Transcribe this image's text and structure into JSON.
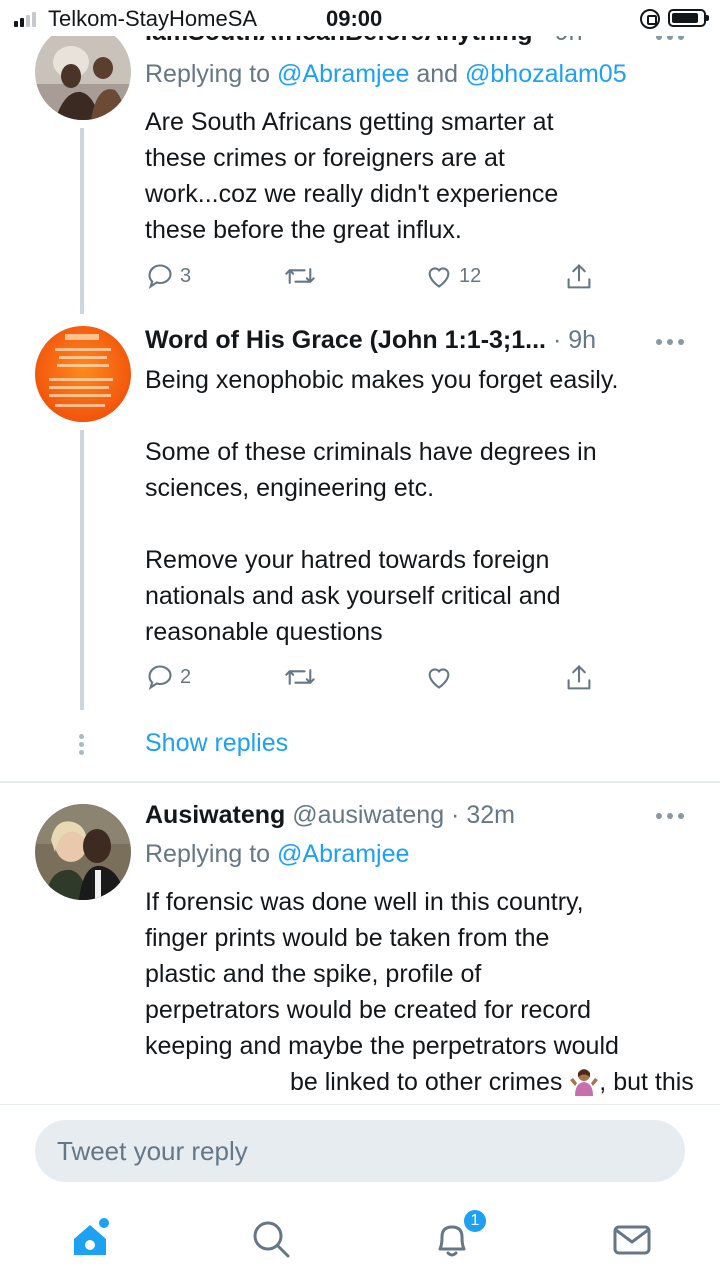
{
  "status_bar": {
    "carrier": "Telkom-StayHomeSA",
    "time": "09:00"
  },
  "tweets": [
    {
      "name": "IamSouthAfricanBeforeAnything",
      "time": "9h",
      "replying_prefix": "Replying to ",
      "mention_1": "@Abramjee",
      "replying_joiner": " and ",
      "mention_2": "@bhozalam05",
      "lines": [
        "Are South Africans getting smarter at",
        "these crimes or foreigners are at",
        "work...coz we really didn't experience",
        "these before the great influx."
      ],
      "reply_count": "3",
      "retweet_count": "",
      "like_count": "12"
    },
    {
      "name": "Word of His Grace (John 1:1-3;1...",
      "time": "9h",
      "paragraphs": [
        [
          "Being xenophobic makes you forget easily."
        ],
        [
          "Some of these criminals have degrees in",
          "sciences, engineering etc."
        ],
        [
          "Remove your hatred towards foreign",
          "nationals and ask yourself critical and",
          "reasonable questions"
        ]
      ],
      "reply_count": "2",
      "retweet_count": "",
      "like_count": ""
    },
    {
      "name": "Ausiwateng",
      "handle": "@ausiwateng",
      "time": "32m",
      "replying_prefix": "Replying to ",
      "mention_1": "@Abramjee",
      "lines": [
        "If forensic was done well in this country,",
        "finger prints would be taken from the",
        "plastic and the spike, profile of",
        "perpetrators would be created for record",
        "keeping and maybe the perpetrators would"
      ],
      "last_line_before_emoji": "be linked to other crimes ",
      "last_line_after_emoji": ", but this is SA"
    }
  ],
  "show_replies": "Show replies",
  "compose": {
    "placeholder": "Tweet your reply"
  },
  "tab_bar": {
    "notification_badge": "1"
  },
  "colors": {
    "accent": "#1da1f2",
    "text": "#14171a",
    "secondary_text": "#657786",
    "divider": "#e6ecf0"
  }
}
